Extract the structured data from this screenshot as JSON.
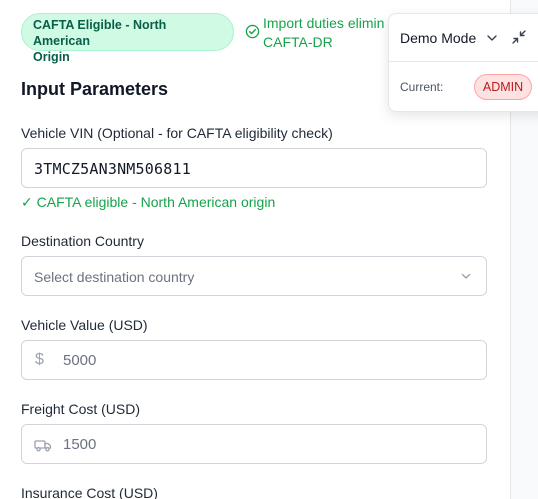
{
  "status": {
    "badge_label_line1": "CAFTA Eligible - North American",
    "badge_label_line2": "Origin",
    "import_note_line1": "Import duties elimin",
    "import_note_line2": "CAFTA-DR"
  },
  "section": {
    "title": "Input Parameters"
  },
  "fields": {
    "vin": {
      "label": "Vehicle VIN (Optional - for CAFTA eligibility check)",
      "value": "3TMCZ5AN3NM506811",
      "validation": "✓ CAFTA eligible - North American origin"
    },
    "destination": {
      "label": "Destination Country",
      "placeholder": "Select destination country"
    },
    "vehicle_value": {
      "label": "Vehicle Value (USD)",
      "prefix": "$",
      "value": "5000"
    },
    "freight": {
      "label": "Freight Cost (USD)",
      "value": "1500"
    },
    "insurance": {
      "label": "Insurance Cost (USD)"
    }
  },
  "demo": {
    "mode_label": "Demo Mode",
    "current_label": "Current:",
    "role": "ADMIN"
  },
  "colors": {
    "success": "#16a34a",
    "badge_bg": "#d1fae5",
    "role_bg": "#fee2e2",
    "role_text": "#b91c1c"
  },
  "icons": [
    "check-circle-icon",
    "chevron-down-icon",
    "collapse-icon",
    "dollar-icon",
    "truck-icon"
  ]
}
